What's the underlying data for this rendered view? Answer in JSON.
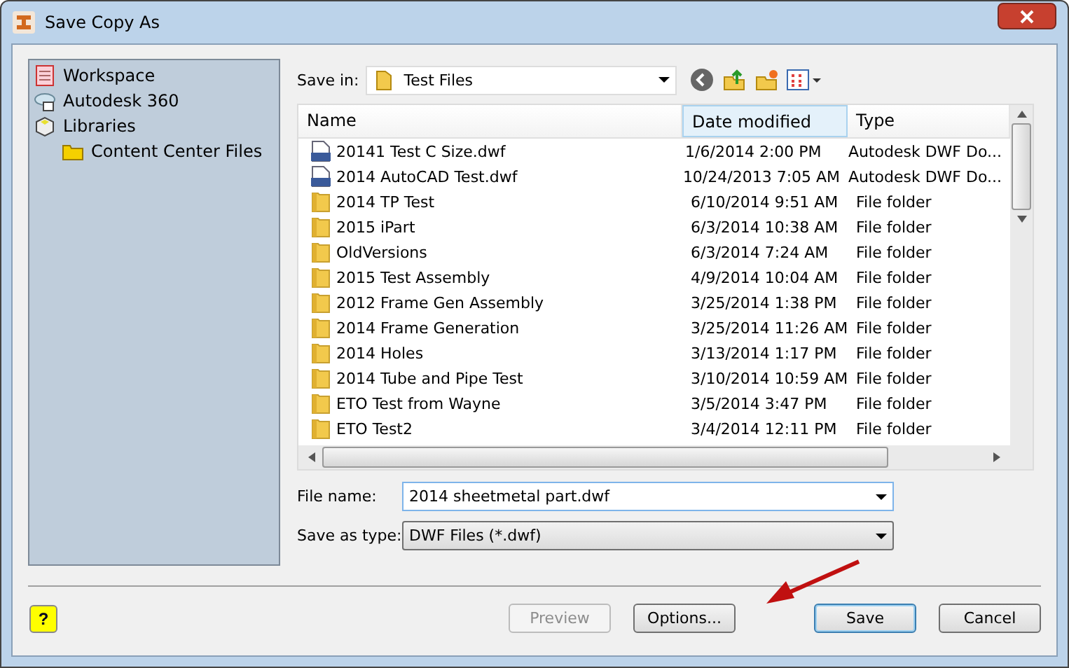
{
  "window": {
    "title": "Save Copy As"
  },
  "places": [
    {
      "label": "Workspace",
      "kind": "workspace"
    },
    {
      "label": "Autodesk 360",
      "kind": "cloud"
    },
    {
      "label": "Libraries",
      "kind": "libraries",
      "children": [
        {
          "label": "Content Center Files",
          "kind": "folder"
        }
      ]
    }
  ],
  "save_in": {
    "label": "Save in:",
    "value": "Test Files"
  },
  "columns": [
    {
      "label": "Name",
      "sorted": false
    },
    {
      "label": "Date modified",
      "sorted": true
    },
    {
      "label": "Type",
      "sorted": false
    }
  ],
  "rows": [
    {
      "kind": "dwf",
      "name": "20141 Test C Size.dwf",
      "date": "1/6/2014 2:00 PM",
      "type": "Autodesk DWF Do..."
    },
    {
      "kind": "dwf",
      "name": "2014 AutoCAD Test.dwf",
      "date": "10/24/2013 7:05 AM",
      "type": "Autodesk DWF Do..."
    },
    {
      "kind": "folder",
      "name": "2014 TP Test",
      "date": "6/10/2014 9:51 AM",
      "type": "File folder"
    },
    {
      "kind": "folder",
      "name": "2015 iPart",
      "date": "6/3/2014 10:38 AM",
      "type": "File folder"
    },
    {
      "kind": "folder",
      "name": "OldVersions",
      "date": "6/3/2014 7:24 AM",
      "type": "File folder"
    },
    {
      "kind": "folder",
      "name": "2015 Test Assembly",
      "date": "4/9/2014 10:04 AM",
      "type": "File folder"
    },
    {
      "kind": "folder",
      "name": "2012 Frame Gen Assembly",
      "date": "3/25/2014 1:38 PM",
      "type": "File folder"
    },
    {
      "kind": "folder",
      "name": "2014 Frame Generation",
      "date": "3/25/2014 11:26 AM",
      "type": "File folder"
    },
    {
      "kind": "folder",
      "name": "2014 Holes",
      "date": "3/13/2014 1:17 PM",
      "type": "File folder"
    },
    {
      "kind": "folder",
      "name": "2014 Tube and Pipe Test",
      "date": "3/10/2014 10:59 AM",
      "type": "File folder"
    },
    {
      "kind": "folder",
      "name": "ETO Test from Wayne",
      "date": "3/5/2014 3:47 PM",
      "type": "File folder"
    },
    {
      "kind": "folder",
      "name": "ETO Test2",
      "date": "3/4/2014 12:11 PM",
      "type": "File folder"
    }
  ],
  "file_name": {
    "label": "File name:",
    "value": "2014 sheetmetal part.dwf"
  },
  "save_as_type": {
    "label": "Save as type:",
    "value": "DWF Files (*.dwf)"
  },
  "help": {
    "label": "?"
  },
  "buttons": [
    {
      "label": "Preview",
      "disabled": true,
      "default": false
    },
    {
      "label": "Options...",
      "disabled": false,
      "default": false
    },
    {
      "label": "Save",
      "disabled": false,
      "default": true
    },
    {
      "label": "Cancel",
      "disabled": false,
      "default": false
    }
  ]
}
